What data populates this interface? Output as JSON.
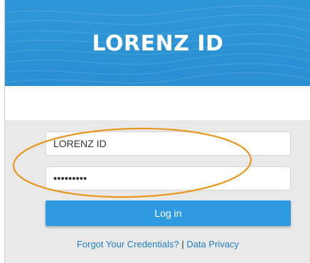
{
  "header": {
    "title": "LORENZ ID"
  },
  "form": {
    "username_value": "LORENZ ID",
    "password_value": "•••••••••",
    "login_label": "Log in"
  },
  "links": {
    "forgot": "Forgot Your Credentials?",
    "separator": " | ",
    "privacy": "Data Privacy"
  },
  "colors": {
    "header_blue": "#2f97d8",
    "button_blue": "#2e9be0",
    "link_blue": "#1f7fc2",
    "panel_gray": "#e9e9e9",
    "annotation_orange": "#e8961e"
  }
}
